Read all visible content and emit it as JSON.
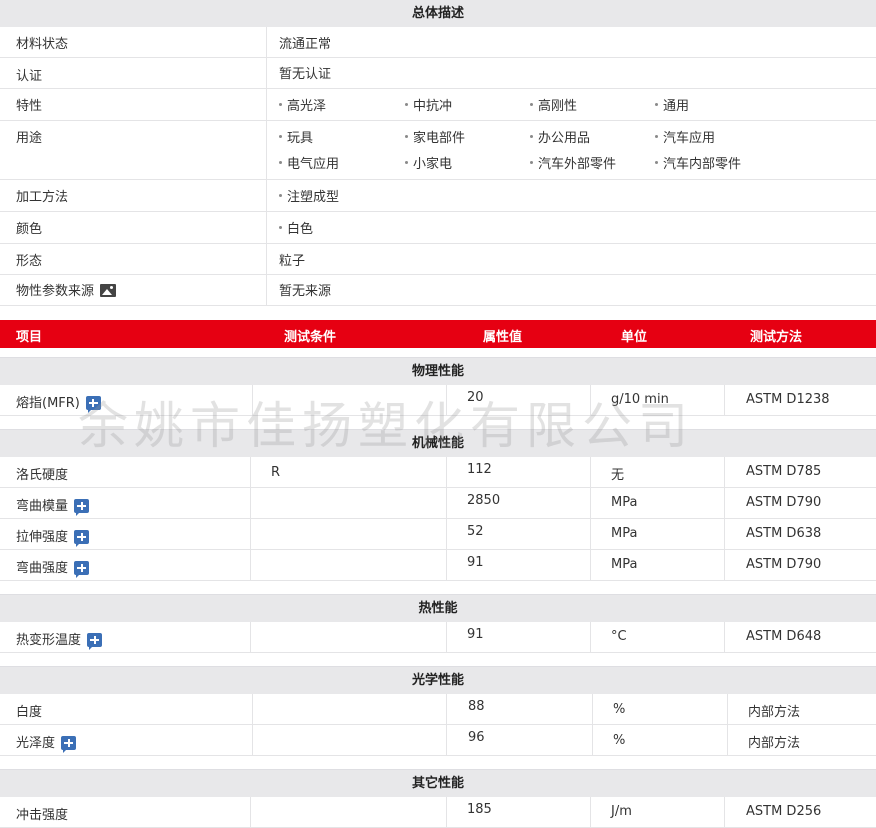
{
  "general": {
    "title": "总体描述",
    "rows": {
      "material_state": {
        "label": "材料状态",
        "value": "流通正常"
      },
      "certification": {
        "label": "认证",
        "value": "暂无认证"
      },
      "features": {
        "label": "特性",
        "items": [
          "高光泽",
          "中抗冲",
          "高刚性",
          "通用"
        ]
      },
      "usage": {
        "label": "用途",
        "items": [
          "玩具",
          "家电部件",
          "办公用品",
          "汽车应用",
          "电气应用",
          "小家电",
          "汽车外部零件",
          "汽车内部零件"
        ]
      },
      "processing": {
        "label": "加工方法",
        "items": [
          "注塑成型"
        ]
      },
      "color": {
        "label": "颜色",
        "items": [
          "白色"
        ]
      },
      "form": {
        "label": "形态",
        "value": "粒子"
      },
      "source": {
        "label": "物性参数来源",
        "value": "暂无来源"
      }
    }
  },
  "header": {
    "item": "项目",
    "condition": "测试条件",
    "value": "属性值",
    "unit": "单位",
    "method": "测试方法"
  },
  "watermark": "余姚市佳扬塑化有限公司",
  "sections": {
    "physical": {
      "title": "物理性能",
      "rows": [
        {
          "name": "熔指(MFR)",
          "condition": "",
          "value": "20",
          "unit": "g/10 min",
          "method": "ASTM D1238"
        }
      ]
    },
    "mechanical": {
      "title": "机械性能",
      "rows": [
        {
          "name": "洛氏硬度",
          "condition": "R",
          "value": "112",
          "unit": "无",
          "method": "ASTM D785"
        },
        {
          "name": "弯曲模量",
          "condition": "",
          "value": "2850",
          "unit": "MPa",
          "method": "ASTM D790"
        },
        {
          "name": "拉伸强度",
          "condition": "",
          "value": "52",
          "unit": "MPa",
          "method": "ASTM D638"
        },
        {
          "name": "弯曲强度",
          "condition": "",
          "value": "91",
          "unit": "MPa",
          "method": "ASTM D790"
        }
      ]
    },
    "thermal": {
      "title": "热性能",
      "rows": [
        {
          "name": "热变形温度",
          "condition": "",
          "value": "91",
          "unit": "°C",
          "method": "ASTM D648"
        }
      ]
    },
    "optical": {
      "title": "光学性能",
      "rows": [
        {
          "name": "白度",
          "condition": "",
          "value": "88",
          "unit": "%",
          "method": "内部方法"
        },
        {
          "name": "光泽度",
          "condition": "",
          "value": "96",
          "unit": "%",
          "method": "内部方法"
        }
      ]
    },
    "other": {
      "title": "其它性能",
      "rows": [
        {
          "name": "冲击强度",
          "condition": "",
          "value": "185",
          "unit": "J/m",
          "method": "ASTM D256"
        }
      ]
    }
  },
  "colors": {
    "accent": "#e60012",
    "band": "#e8e8ea",
    "icon_blue": "#3b6fb6"
  }
}
